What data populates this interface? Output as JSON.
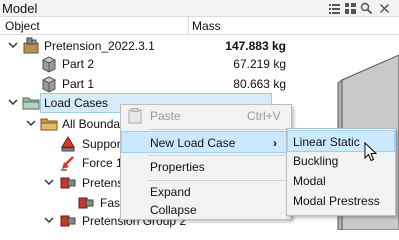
{
  "panel": {
    "title": "Model"
  },
  "columns": {
    "object": "Object",
    "mass": "Mass"
  },
  "tree": {
    "root": {
      "label": "Pretension_2022.3.1",
      "mass": "147.883 kg"
    },
    "part2": {
      "label": "Part 2",
      "mass": "67.219 kg"
    },
    "part1": {
      "label": "Part 1",
      "mass": "80.663 kg"
    },
    "loadcases": {
      "label": "Load Cases"
    },
    "boundary": {
      "label": "All Boundary"
    },
    "support": {
      "label": "Support"
    },
    "force": {
      "label": "Force 1"
    },
    "pretension1": {
      "label": "Pretensi"
    },
    "fastener": {
      "label": "Fast"
    },
    "pretension2": {
      "label": "Pretension Group 2"
    }
  },
  "context_menu": {
    "paste": {
      "label": "Paste",
      "shortcut": "Ctrl+V"
    },
    "new_load_case": {
      "label": "New Load Case",
      "submenu_arrow": "›"
    },
    "properties": {
      "label": "Properties"
    },
    "expand": {
      "label": "Expand"
    },
    "collapse": {
      "label": "Collapse"
    }
  },
  "submenu": {
    "items": [
      "Linear Static",
      "Buckling",
      "Modal",
      "Modal Prestress"
    ]
  },
  "colors": {
    "selection": "#d6eaf8",
    "menu_highlight": "#cce8ff",
    "viewport_solid": "#c9c9c9"
  }
}
